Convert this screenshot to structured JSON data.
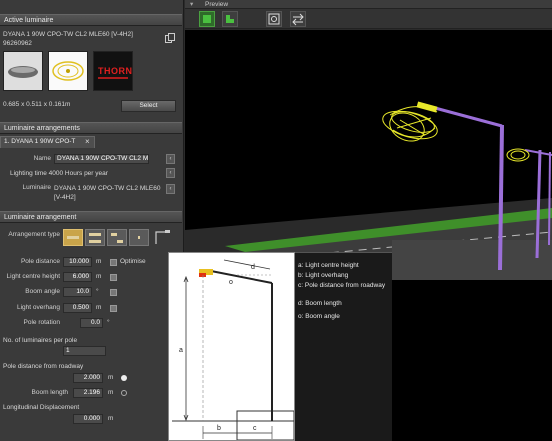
{
  "active_luminaire": {
    "section_title": "Active luminaire",
    "name": "DYANA 1 90W CPO-TW CL2 MLE60 [V-4H2]",
    "code": "96260962",
    "brand_logo": "THORN",
    "dimensions": "0.685 x 0.511 x 0.161m",
    "select_label": "Select"
  },
  "arrangements": {
    "section_title": "Luminaire arrangements",
    "tab_label": "1. DYANA 1 90W CPO-T",
    "name_label": "Name",
    "name_value": "DYANA 1 90W CPO-TW CL2 M",
    "lighting_time": "Lighting time 4000 Hours per year",
    "luminaire_label": "Luminaire",
    "luminaire_line1": "DYANA 1 90W CPO-TW CL2 MLE60",
    "luminaire_line2": "[V-4H2]"
  },
  "arrangement": {
    "section_title": "Luminaire arrangement",
    "type_label": "Arrangement type",
    "pole_distance_label": "Pole distance",
    "pole_distance": "10.000",
    "pole_distance_unit": "m",
    "optimise_label": "Optimise",
    "light_centre_height_label": "Light centre height",
    "light_centre_height": "6.000",
    "light_centre_height_unit": "m",
    "boom_angle_label": "Boom angle",
    "boom_angle": "10.0",
    "boom_angle_unit": "°",
    "light_overhang_label": "Light overhang",
    "light_overhang": "0.500",
    "light_overhang_unit": "m",
    "pole_rotation_label": "Pole rotation",
    "pole_rotation": "0.0",
    "pole_rotation_unit": "°",
    "luminaires_per_pole_label": "No. of luminaires per pole",
    "luminaires_per_pole": "1",
    "pole_distance_roadway_label": "Pole distance from roadway",
    "pole_distance_roadway": "2.000",
    "pole_distance_roadway_unit": "m",
    "boom_length_label": "Boom length",
    "boom_length": "2.196",
    "boom_length_unit": "m",
    "longitudinal_label": "Longitudinal Displacement",
    "longitudinal": "0.000",
    "longitudinal_unit": "m"
  },
  "preview": {
    "title": "Preview",
    "tools": [
      "green-box-icon",
      "green-floor-icon",
      "fit-view-icon",
      "arrows-icon"
    ]
  },
  "diagram": {
    "labels": [
      "a",
      "b",
      "c",
      "d",
      "o"
    ],
    "legend": [
      "a: Light centre height",
      "b: Light overhang",
      "c: Pole distance from roadway",
      "d: Boom length",
      "o: Boom angle"
    ]
  },
  "colors": {
    "panel": "#3a3a3a",
    "header": "#4a4a4a",
    "pole": "#9b6fd8",
    "luminaire": "#e8e82a",
    "grass": "#3f8f2a",
    "accent": "#c9a44a"
  }
}
